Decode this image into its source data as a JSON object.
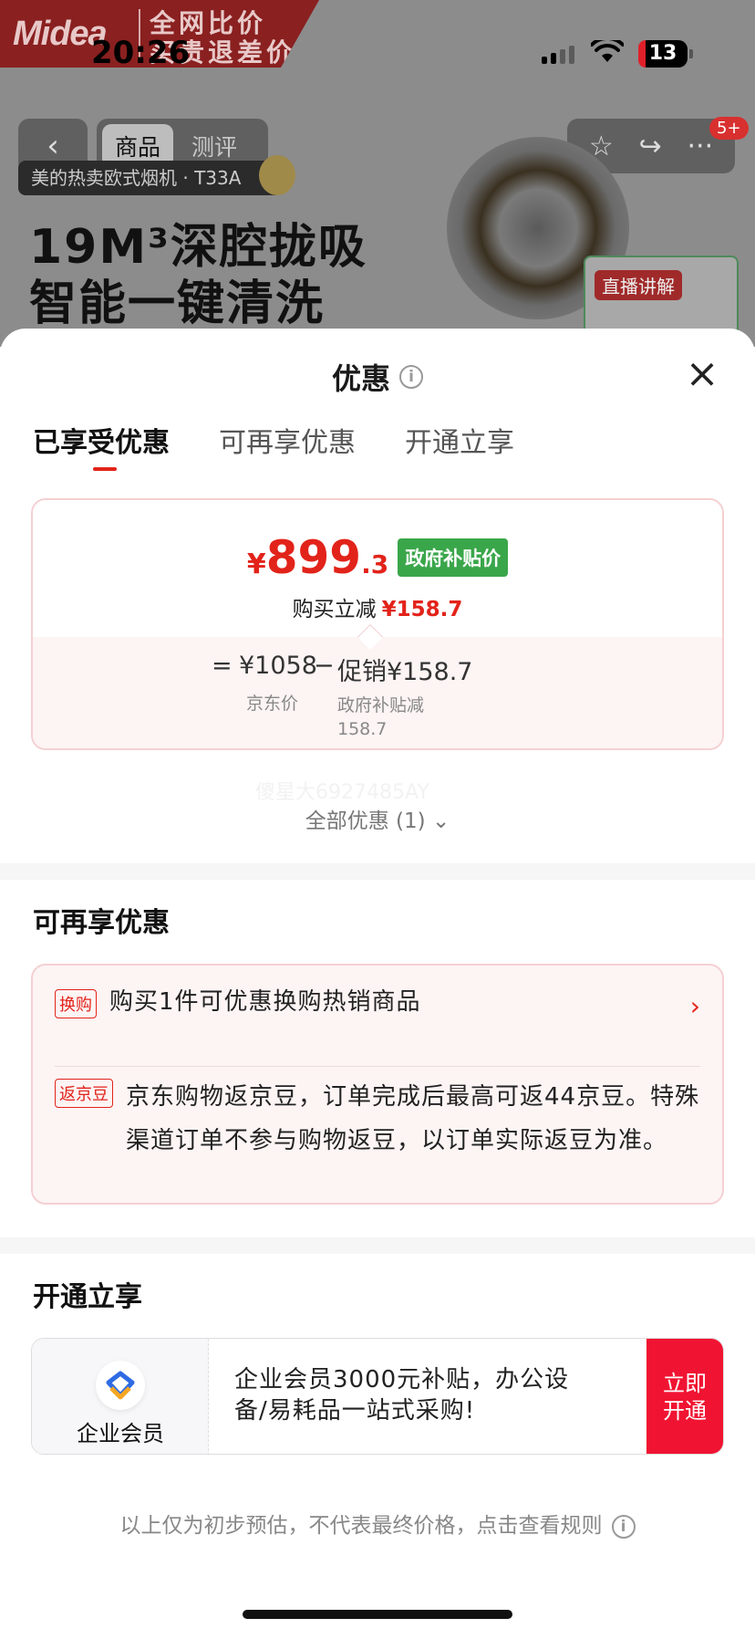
{
  "status_bar": {
    "time": "20:26",
    "battery": "13"
  },
  "background": {
    "brand_logo": "Midea",
    "banner_line1": "全网比价",
    "banner_line2": "买贵退差价",
    "nav_tabs": [
      {
        "label": "商品",
        "active": true
      },
      {
        "label": "测评",
        "active": false
      }
    ],
    "cart_badge": "5+",
    "product_tag": "美的热卖欧式烟机 · T33A",
    "hero_line1": "19M³深腔拢吸",
    "hero_line2": "智能一键清洗",
    "live_tag": "直播讲解"
  },
  "sheet": {
    "title": "优惠",
    "tabs": [
      {
        "label": "已享受优惠",
        "active": true
      },
      {
        "label": "可再享优惠",
        "active": false
      },
      {
        "label": "开通立享",
        "active": false
      }
    ],
    "price_card": {
      "currency": "¥",
      "price_int": "899",
      "price_dec": ".3",
      "price_tag": "政府补贴价",
      "instant_label": "购买立减",
      "instant_amount": "¥158.7",
      "equals": "=",
      "base_price": "¥1058",
      "minus": "−",
      "promo_price": "促销¥158.7",
      "base_label": "京东价",
      "promo_label_line1": "政府补贴减",
      "promo_label_line2": "158.7"
    },
    "watermark": "傻星大6927485AY",
    "all_offers": "全部优惠 (1)",
    "section_more": {
      "title": "可再享优惠",
      "items": [
        {
          "tag": "换购",
          "text": "购买1件可优惠换购热销商品"
        },
        {
          "tag": "返京豆",
          "text": "京东购物返京豆，订单完成后最高可返44京豆。特殊渠道订单不参与购物返豆，以订单实际返豆为准。"
        }
      ]
    },
    "section_open": {
      "title": "开通立享",
      "member_name": "企业会员",
      "member_desc": "企业会员3000元补贴，办公设备/易耗品一站式采购!",
      "button": "立即开通"
    },
    "disclaimer": "以上仅为初步预估，不代表最终价格，点击查看规则"
  },
  "colors": {
    "accent": "#e2231a",
    "gov_green": "#3aa64a",
    "button_red": "#f01432"
  }
}
